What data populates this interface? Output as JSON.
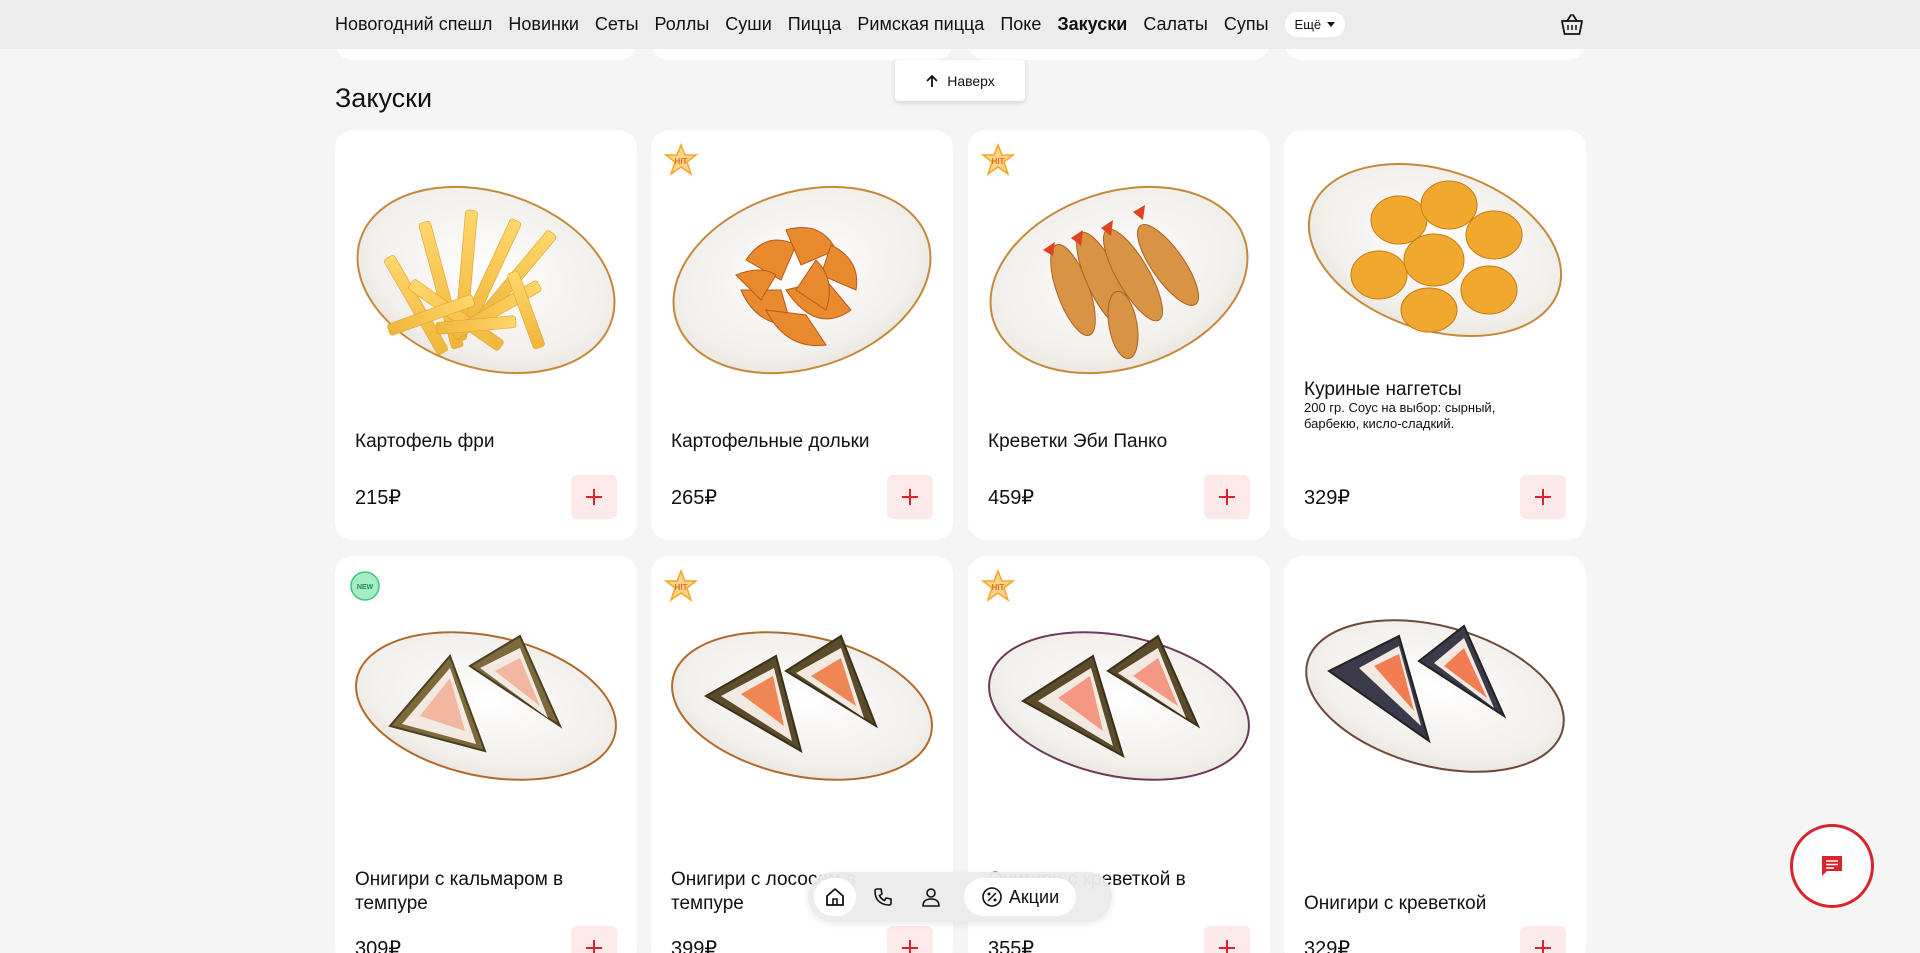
{
  "nav": {
    "items": [
      {
        "label": "Новогодний спешл",
        "active": false
      },
      {
        "label": "Новинки",
        "active": false
      },
      {
        "label": "Сеты",
        "active": false
      },
      {
        "label": "Роллы",
        "active": false
      },
      {
        "label": "Суши",
        "active": false
      },
      {
        "label": "Пицца",
        "active": false
      },
      {
        "label": "Римская пицца",
        "active": false
      },
      {
        "label": "Поке",
        "active": false
      },
      {
        "label": "Закуски",
        "active": true
      },
      {
        "label": "Салаты",
        "active": false
      },
      {
        "label": "Супы",
        "active": false
      }
    ],
    "more_label": "Ещё",
    "cart_icon": "basket-icon"
  },
  "scroll_up": {
    "label": "Наверх",
    "icon": "arrow-up-icon"
  },
  "section": {
    "title": "Закуски"
  },
  "products": [
    {
      "name": "Картофель фри",
      "desc": "",
      "price": "215₽",
      "badge": "",
      "image": "fries"
    },
    {
      "name": "Картофельные дольки",
      "desc": "",
      "price": "265₽",
      "badge": "HIT",
      "image": "wedges"
    },
    {
      "name": "Креветки Эби Панко",
      "desc": "",
      "price": "459₽",
      "badge": "HIT",
      "image": "shrimp"
    },
    {
      "name": "Куриные наггетсы",
      "desc": "200 гр. Соус на выбор: сырный, барбекю, кисло-сладкий.",
      "price": "329₽",
      "badge": "",
      "image": "nuggets"
    },
    {
      "name": "Онигири с кальмаром в темпуре",
      "desc": "",
      "price": "309₽",
      "badge": "NEW",
      "image": "onigiri-squid"
    },
    {
      "name": "Онигири с лососем в темпуре",
      "desc": "",
      "price": "399₽",
      "badge": "HIT",
      "image": "onigiri-salmon"
    },
    {
      "name": "Онигири с креветкой в темпуре",
      "desc": "",
      "price": "355₽",
      "badge": "HIT",
      "image": "onigiri-shrimp-tempura"
    },
    {
      "name": "Онигири с креветкой",
      "desc": "",
      "price": "329₽",
      "badge": "",
      "image": "onigiri-shrimp"
    }
  ],
  "bottom_bar": {
    "home_icon": "home-icon",
    "phone_icon": "phone-icon",
    "profile_icon": "user-icon",
    "promo_label": "Акции",
    "promo_icon": "percent-icon"
  },
  "chat": {
    "icon": "chat-icon"
  },
  "colors": {
    "accent": "#d9232d",
    "add_bg": "#fce9e9",
    "page_bg": "#f5f5f5",
    "nav_bg": "#ececec",
    "hit_badge": "#f5a623",
    "new_badge": "#3cc67a"
  }
}
